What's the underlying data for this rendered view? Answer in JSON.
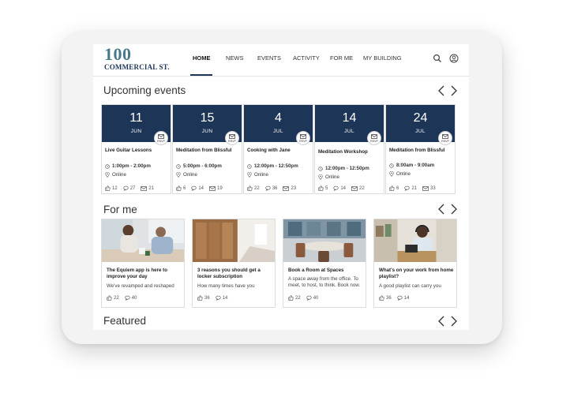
{
  "brand": {
    "number": "100",
    "name": "COMMERCIAL ST."
  },
  "nav": [
    {
      "label": "HOME",
      "active": true
    },
    {
      "label": "NEWS"
    },
    {
      "label": "EVENTS"
    },
    {
      "label": "ACTIVITY"
    },
    {
      "label": "FOR ME"
    },
    {
      "label": "MY BUILDING"
    }
  ],
  "header_icons": [
    "search-icon",
    "user-icon"
  ],
  "colors": {
    "brand_navy": "#1d3557",
    "logo_teal": "#4a7a8a"
  },
  "upcoming": {
    "title": "Upcoming events",
    "rsvp_label": "RSVP",
    "events": [
      {
        "day": "11",
        "month": "JUN",
        "title": "Live Guitar Lessons",
        "time": "1:00pm - 2:00pm",
        "location": "Online",
        "likes": "12",
        "comments": "27",
        "shares": "21"
      },
      {
        "day": "15",
        "month": "JUN",
        "title": "Meditation from Blissful",
        "time": "5:00pm - 6:00pm",
        "location": "Online",
        "likes": "6",
        "comments": "14",
        "shares": "19"
      },
      {
        "day": "4",
        "month": "JUL",
        "title": "Cooking with Jane",
        "time": "12:00pm - 12:50pm",
        "location": "Online",
        "likes": "22",
        "comments": "36",
        "shares": "23"
      },
      {
        "day": "14",
        "month": "JUL",
        "title": "Meditation Workshop",
        "time": "12:00pm - 12:50pm",
        "location": "Online",
        "likes": "5",
        "comments": "14",
        "shares": "22"
      },
      {
        "day": "24",
        "month": "JUL",
        "title": "Meditation from Blissful",
        "time": "8:00am - 9:00am",
        "location": "Online",
        "likes": "6",
        "comments": "21",
        "shares": "33"
      }
    ]
  },
  "forme": {
    "title": "For me",
    "cards": [
      {
        "title": "The Equiem app is here to improve your day",
        "desc": "We've revamped and reshaped",
        "likes": "22",
        "comments": "40"
      },
      {
        "title": "3 reasons you should get a locker subscription",
        "desc": "How many times have you",
        "likes": "36",
        "comments": "14"
      },
      {
        "title": "Book a Room at Spaces",
        "desc": "A space away from the office. To meet, to host, to think. Book now.",
        "likes": "22",
        "comments": "40"
      },
      {
        "title": "What's on your work from home playlist?",
        "desc": "A good playlist can carry you",
        "likes": "36",
        "comments": "14"
      }
    ]
  },
  "featured": {
    "title": "Featured"
  }
}
